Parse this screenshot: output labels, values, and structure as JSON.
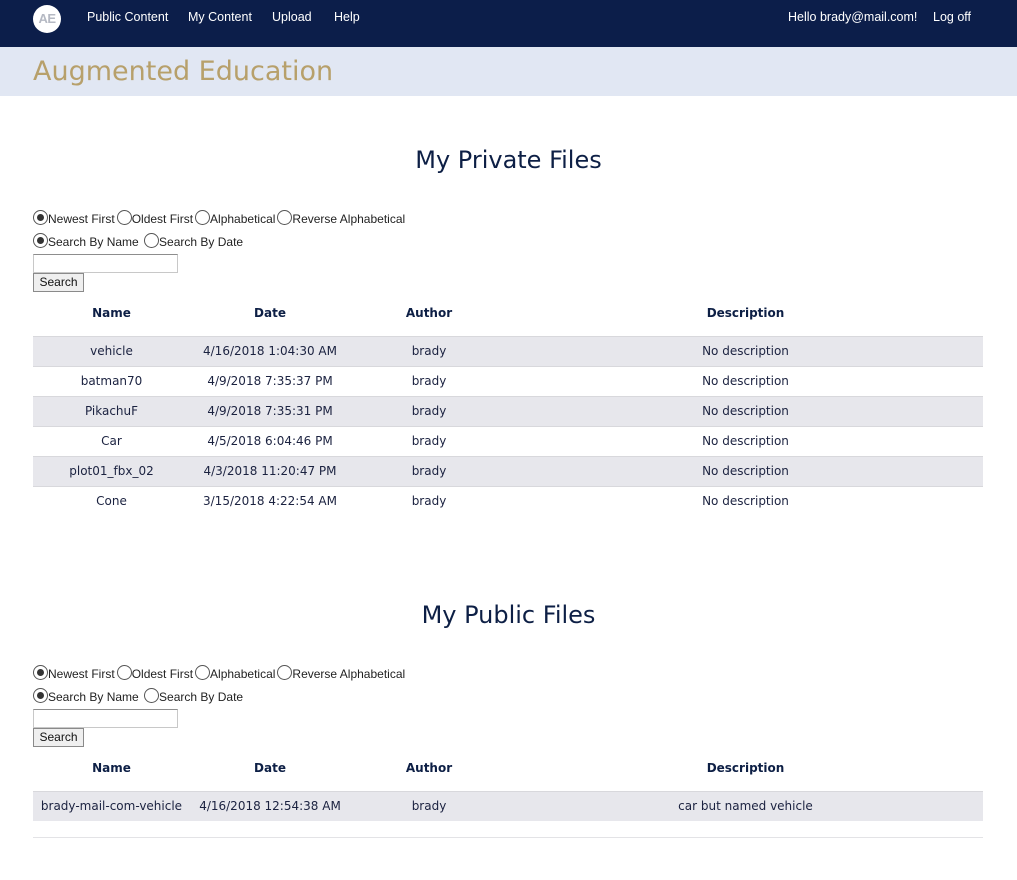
{
  "nav": {
    "logo_text": "AE",
    "links": [
      "Public Content",
      "My Content",
      "Upload",
      "Help"
    ],
    "greeting": "Hello brady@mail.com!",
    "logoff": "Log off",
    "bg_color": "#0c1e4a"
  },
  "banner": {
    "brand": "Augmented Education",
    "brand_color": "#b7a06b",
    "bg_color": "#e1e7f3"
  },
  "sort_options": [
    "Newest First",
    "Oldest First",
    "Alphabetical",
    "Reverse Alphabetical"
  ],
  "search_options": [
    "Search By Name",
    "Search By Date"
  ],
  "search_button": "Search",
  "columns": [
    "Name",
    "Date",
    "Author",
    "Description"
  ],
  "private_section": {
    "title": "My Private Files",
    "selected_sort": "Newest First",
    "selected_search": "Search By Name",
    "search_value": "",
    "rows": [
      {
        "name": "vehicle",
        "date": "4/16/2018 1:04:30 AM",
        "author": "brady",
        "description": "No description"
      },
      {
        "name": "batman70",
        "date": "4/9/2018 7:35:37 PM",
        "author": "brady",
        "description": "No description"
      },
      {
        "name": "PikachuF",
        "date": "4/9/2018 7:35:31 PM",
        "author": "brady",
        "description": "No description"
      },
      {
        "name": "Car",
        "date": "4/5/2018 6:04:46 PM",
        "author": "brady",
        "description": "No description"
      },
      {
        "name": "plot01_fbx_02",
        "date": "4/3/2018 11:20:47 PM",
        "author": "brady",
        "description": "No description"
      },
      {
        "name": "Cone",
        "date": "3/15/2018 4:22:54 AM",
        "author": "brady",
        "description": "No description"
      }
    ]
  },
  "public_section": {
    "title": "My Public Files",
    "selected_sort": "Newest First",
    "selected_search": "Search By Name",
    "search_value": "",
    "rows": [
      {
        "name": "brady-mail-com-vehicle",
        "date": "4/16/2018 12:54:38 AM",
        "author": "brady",
        "description": "car but named vehicle"
      }
    ]
  }
}
